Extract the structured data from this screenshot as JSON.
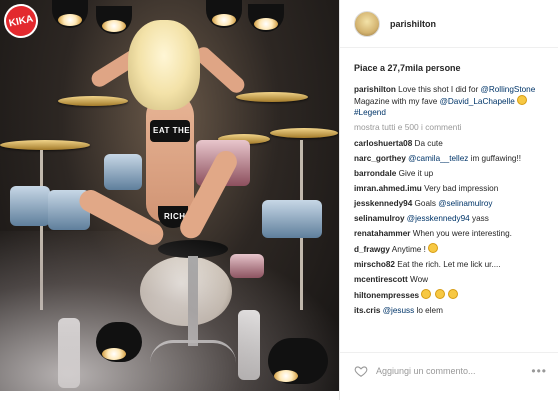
{
  "post": {
    "username": "parishilton",
    "likes_text": "Piace a 27,7mila persone"
  },
  "caption": {
    "user": "parishilton",
    "text_1": "Love this shot I did for",
    "mention_1": "@RollingStone",
    "text_2": "Magazine with my fave",
    "mention_2": "@David_LaChapelle",
    "hashtag": "#Legend"
  },
  "comments_more": "mostra tutti e 500 i commenti",
  "comments": [
    {
      "user": "carloshuerta08",
      "text": "Da cute"
    },
    {
      "user": "narc_gorthey",
      "mention": "@camila__tellez",
      "text": "im guffawing!!"
    },
    {
      "user": "barrondale",
      "text": "Give it up"
    },
    {
      "user": "imran.ahmed.imu",
      "text": "Very bad impression"
    },
    {
      "user": "jesskennedy94",
      "text": "Goals",
      "mention": "@selinamulroy"
    },
    {
      "user": "selinamulroy",
      "mention": "@jesskennedy94",
      "text": "yass"
    },
    {
      "user": "renatahammer",
      "text": "When you were interesting."
    },
    {
      "user": "d_frawgy",
      "text": "Anytime !"
    },
    {
      "user": "mirscho82",
      "text": "Eat the rich. Let me lick ur...."
    },
    {
      "user": "mcentirescott",
      "text": "Wow"
    },
    {
      "user": "hiltonempresses",
      "text": ""
    },
    {
      "user": "its.cris",
      "mention": "@jesuss",
      "text": "lo elem"
    }
  ],
  "footer": {
    "placeholder": "Aggiungi un commento...",
    "more_icon": "ellipsis-icon",
    "like_icon": "heart-icon"
  },
  "photo": {
    "brand_text": "KIKA",
    "bikini_top_text": "EAT THE",
    "bikini_bottom_text": "RICH"
  },
  "colors": {
    "link": "#003569",
    "text": "#262626",
    "muted": "#999999",
    "brand_badge": "#e3292e"
  }
}
